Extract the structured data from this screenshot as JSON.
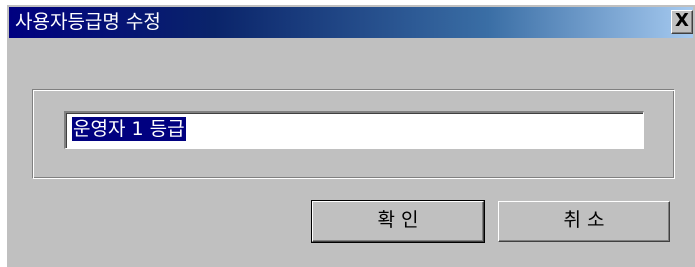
{
  "window": {
    "title": "사용자등급명 수정",
    "close_label": "X"
  },
  "form": {
    "grade_name_value": "운영자 1 등급"
  },
  "buttons": {
    "ok_label": "확 인",
    "cancel_label": "취 소"
  },
  "colors": {
    "titlebar_start": "#000080",
    "titlebar_end": "#a6caf0",
    "face": "#c0c0c0",
    "selection": "#000080"
  }
}
